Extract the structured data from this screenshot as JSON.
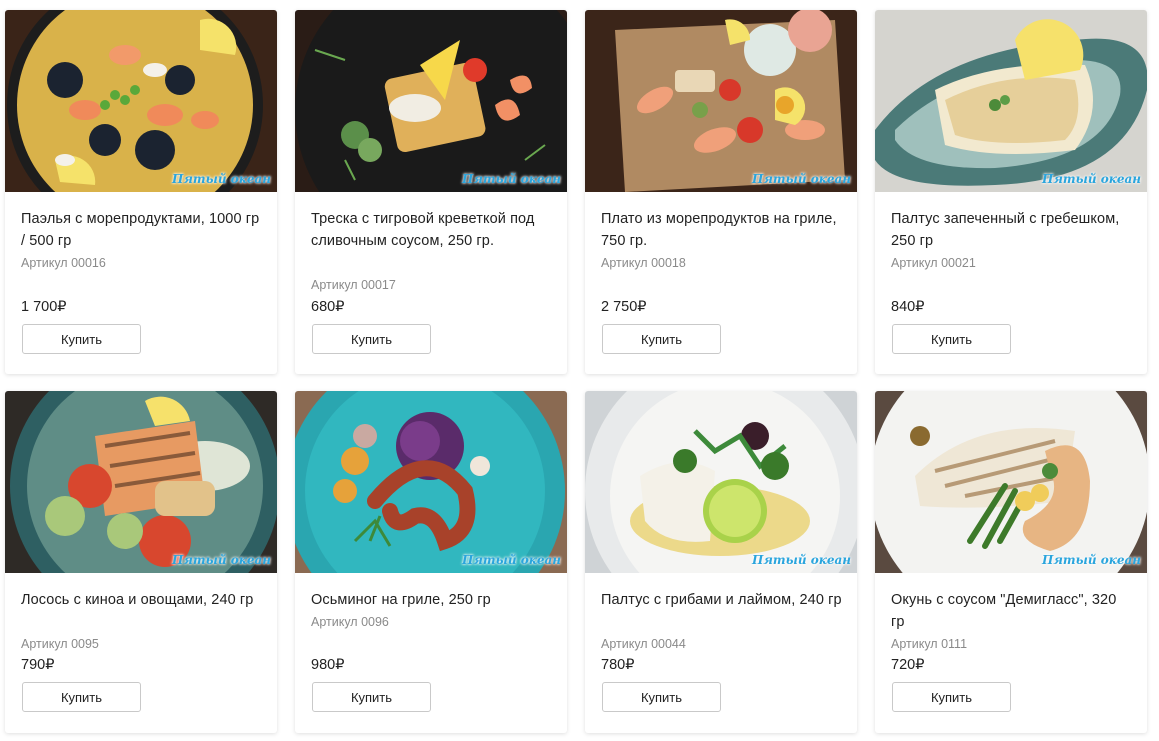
{
  "brand": {
    "watermark": "Пятый океан",
    "accent": "#2aa5dd"
  },
  "products": [
    {
      "title": "Паэлья с морепродуктами, 1000 гр / 500 гр",
      "sku": "Артикул 00016",
      "price": "1 700₽",
      "buy": "Купить"
    },
    {
      "title": "Треска с тигровой креветкой под сливочным соусом, 250 гр.",
      "sku": "Артикул 00017",
      "price": "680₽",
      "buy": "Купить"
    },
    {
      "title": "Плато из морепродуктов на гриле, 750 гр.",
      "sku": "Артикул 00018",
      "price": "2 750₽",
      "buy": "Купить"
    },
    {
      "title": "Палтус запеченный с гребешком, 250 гр",
      "sku": "Артикул 00021",
      "price": "840₽",
      "buy": "Купить"
    },
    {
      "title": "Лосось с киноа и овощами, 240 гр",
      "sku": "Артикул 0095",
      "price": "790₽",
      "buy": "Купить"
    },
    {
      "title": "Осьминог на гриле, 250 гр",
      "sku": "Артикул 0096",
      "price": "980₽",
      "buy": "Купить"
    },
    {
      "title": "Палтус с грибами и лаймом, 240 гр",
      "sku": "Артикул 00044",
      "price": "780₽",
      "buy": "Купить"
    },
    {
      "title": "Окунь с соусом \"Демигласс\", 320 гр",
      "sku": "Артикул 0111",
      "price": "720₽",
      "buy": "Купить"
    }
  ]
}
